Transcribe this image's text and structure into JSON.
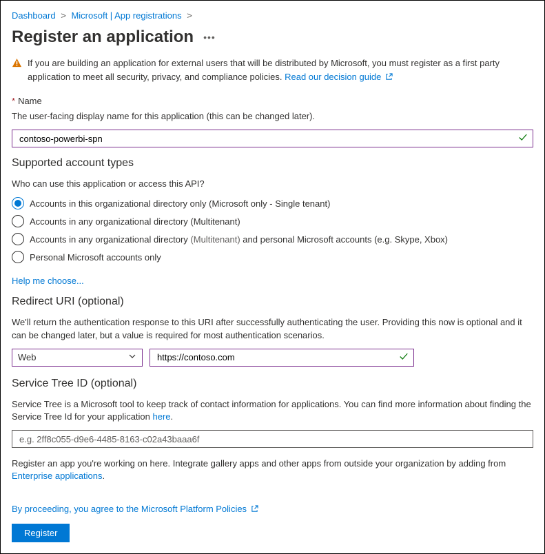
{
  "breadcrumb": {
    "items": [
      "Dashboard",
      "Microsoft | App registrations"
    ]
  },
  "title": "Register an application",
  "warning": {
    "text": "If you are building an application for external users that will be distributed by Microsoft, you must register as a first party application to meet all security, privacy, and compliance policies.",
    "link_text": "Read our decision guide"
  },
  "name_field": {
    "label": "Name",
    "desc": "The user-facing display name for this application (this can be changed later).",
    "value": "contoso-powerbi-spn"
  },
  "account_types": {
    "title": "Supported account types",
    "question": "Who can use this application or access this API?",
    "options": [
      {
        "label": "Accounts in this organizational directory only (Microsoft only - Single tenant)",
        "selected": true
      },
      {
        "label": "Accounts in any organizational directory (Multitenant)",
        "selected": false
      },
      {
        "label_pre": "Accounts in any organizational directory",
        "label_mid": "(Multitenant)",
        "label_post": "and personal Microsoft accounts (e.g. Skype, Xbox)",
        "selected": false
      },
      {
        "label": "Personal Microsoft accounts only",
        "selected": false
      }
    ],
    "help_link": "Help me choose..."
  },
  "redirect": {
    "title": "Redirect URI (optional)",
    "desc": "We'll return the authentication response to this URI after successfully authenticating the user. Providing this now is optional and it can be changed later, but a value is required for most authentication scenarios.",
    "platform": "Web",
    "uri": "https://contoso.com"
  },
  "service_tree": {
    "title": "Service Tree ID (optional)",
    "desc_pre": "Service Tree is a Microsoft tool to keep track of contact information for applications. You can find more information about finding the Service Tree Id for your application ",
    "desc_link": "here",
    "desc_post": ".",
    "placeholder": "e.g. 2ff8c055-d9e6-4485-8163-c02a43baaa6f"
  },
  "footnote": {
    "text_pre": "Register an app you're working on here. Integrate gallery apps and other apps from outside your organization by adding from ",
    "link": "Enterprise applications",
    "text_post": "."
  },
  "agree": {
    "text_pre": "By proceeding, you agree to the ",
    "link": "Microsoft Platform Policies"
  },
  "register_btn": "Register"
}
